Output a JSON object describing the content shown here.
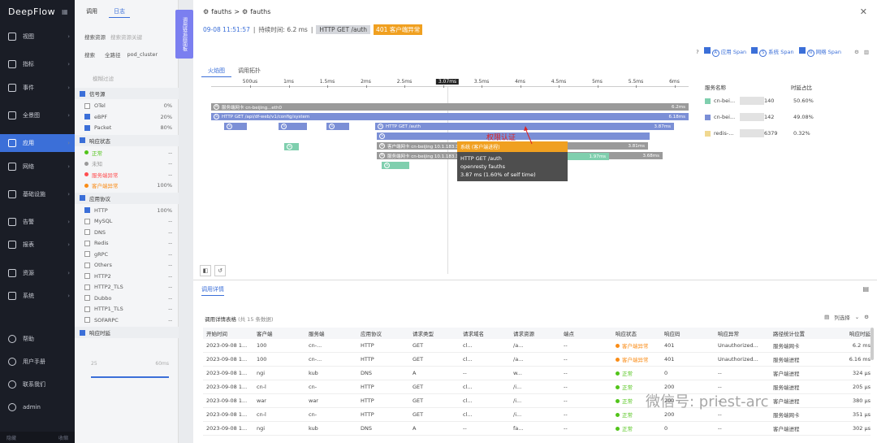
{
  "nav": {
    "logo": "DeepFlow",
    "items": [
      {
        "label": "视图"
      },
      {
        "label": "指标"
      },
      {
        "label": "事件"
      },
      {
        "label": "全景图"
      },
      {
        "label": "应用"
      },
      {
        "label": "网络"
      },
      {
        "label": "基础设施"
      },
      {
        "label": "告警"
      },
      {
        "label": "报表"
      },
      {
        "label": "资源"
      },
      {
        "label": "系统"
      }
    ],
    "bottom": [
      {
        "label": "帮助"
      },
      {
        "label": "用户手册"
      },
      {
        "label": "联系我们"
      },
      {
        "label": "admin"
      }
    ],
    "footer_left": "隐藏",
    "footer_right": "收缩"
  },
  "filter": {
    "tabs": [
      "调用",
      "日志"
    ],
    "search_label": "搜索资源",
    "search_placeholder": "搜索资源关键",
    "row2": [
      "搜索",
      "全路径",
      "pod_cluster"
    ],
    "filter_placeholder": "模糊过滤",
    "sections": [
      {
        "title": "信号源",
        "items": [
          {
            "label": "OTel",
            "count": "0%"
          },
          {
            "label": "eBPF",
            "count": "20%"
          },
          {
            "label": "Packet",
            "count": "80%"
          }
        ]
      },
      {
        "title": "响应状态",
        "items": [
          {
            "label": "正常",
            "count": "--",
            "color": "#52c41a"
          },
          {
            "label": "未知",
            "count": "--",
            "color": "#999999"
          },
          {
            "label": "服务端异常",
            "count": "--",
            "color": "#ff4d4f"
          },
          {
            "label": "客户端异常",
            "count": "100%",
            "color": "#fa8c16"
          }
        ]
      },
      {
        "title": "应用协议",
        "items": [
          {
            "label": "HTTP",
            "count": "100%"
          },
          {
            "label": "MySQL",
            "count": "--"
          },
          {
            "label": "DNS",
            "count": "--"
          },
          {
            "label": "Redis",
            "count": "--"
          },
          {
            "label": "gRPC",
            "count": "--"
          },
          {
            "label": "Others",
            "count": "--"
          },
          {
            "label": "HTTP2",
            "count": "--"
          },
          {
            "label": "HTTP2_TLS",
            "count": "--"
          },
          {
            "label": "Dubbo",
            "count": "--"
          },
          {
            "label": "HTTP1_TLS",
            "count": "--"
          },
          {
            "label": "SOFARPC",
            "count": "--"
          }
        ]
      },
      {
        "title": "响应时延",
        "items": []
      }
    ],
    "range_min": "25",
    "range_max": "60ms"
  },
  "sidetab": "调用链追踪面板",
  "drawer": {
    "breadcrumb": [
      "fauths",
      ">",
      "fauths"
    ],
    "meta": {
      "time": "09-08 11:51:57",
      "duration": "持续时间: 6.2 ms",
      "request": "HTTP GET /auth",
      "code": "401",
      "status": "客户端异常"
    },
    "legend": [
      {
        "label": "应用 Span",
        "tag": "A"
      },
      {
        "label": "系统 Span",
        "tag": "S"
      },
      {
        "label": "网络 Span",
        "tag": "N"
      }
    ],
    "view_tabs": [
      "火焰图",
      "调用拓扑"
    ],
    "ruler": {
      "ticks": [
        "500us",
        "1ms",
        "1.5ms",
        "2ms",
        "2.5ms",
        "3ms",
        "3.5ms",
        "4ms",
        "4.5ms",
        "5ms",
        "5.5ms",
        "6ms"
      ],
      "cursor": "3.07ms"
    },
    "spans": [
      {
        "tag": "N",
        "label": "服务端网卡 cn-beijing...eth0",
        "dur": "6.2ms",
        "color": "#9a9a9a",
        "masked": true
      },
      {
        "tag": "S",
        "label": "HTTP GET /api/df-web/v1/config/system",
        "dur": "6.18ms",
        "color": "#7b8fd6"
      },
      {
        "tag": "S",
        "label": "",
        "dur": "",
        "color": "#7b8fd6"
      },
      {
        "tag": "S",
        "label": "",
        "dur": "",
        "color": "#7b8fd6"
      },
      {
        "tag": "S",
        "label": "",
        "dur": "",
        "color": "#7b8fd6"
      },
      {
        "tag": "S",
        "label": "HTTP GET /auth",
        "dur": "3.87ms",
        "color": "#7b8fd6"
      },
      {
        "tag": "S",
        "label": "",
        "dur": "",
        "color": "#7b8fd6"
      },
      {
        "tag": "N",
        "label": "客户端网卡 cn-beijing 10.1.183.142...",
        "dur": "3.81ms",
        "color": "#9a9a9a"
      },
      {
        "tag": "S",
        "label": "",
        "dur": "",
        "color": "#7fcfae"
      },
      {
        "tag": "N",
        "label": "服务端网卡 cn-beijing 10.1.183.142...",
        "dur": "3.68ms",
        "color": "#9a9a9a"
      },
      {
        "tag": "S",
        "label": "",
        "dur": "",
        "color": "#7fcfae"
      },
      {
        "tag": "",
        "label": "",
        "dur": "1.97ms",
        "color": "#7fcfae"
      }
    ],
    "tooltip": {
      "header": "系统 (客户端进程)",
      "line1": "HTTP GET /auth",
      "line2": "openresty fauths",
      "line3": "3.87 ms (1.60% of self time)"
    },
    "annotation": "权限认证",
    "services": {
      "headers": [
        "服务名称",
        "时延占比"
      ],
      "rows": [
        {
          "name": "cn-bei...",
          "suffix": "140",
          "pct": "50.60%",
          "color": "#7fcfae"
        },
        {
          "name": "cn-bei...",
          "suffix": "142",
          "pct": "49.08%",
          "color": "#7b8fd6"
        },
        {
          "name": "redis-...",
          "suffix": "6379",
          "pct": "0.32%",
          "color": "#f0d890"
        }
      ]
    },
    "section_tab": "调用详情",
    "table": {
      "title": "调用详情表格",
      "count": "(共 15 条数据)",
      "col_select": "列选择",
      "headers": [
        "开始时间",
        "客户端",
        "服务端",
        "应用协议",
        "请求类型",
        "请求域名",
        "请求资源",
        "端点",
        "响应状态",
        "响应码",
        "响应异常",
        "路径统计位置",
        "响应时延"
      ],
      "rows": [
        [
          "2023-09-08 1...",
          "100",
          "cn-...",
          "HTTP",
          "GET",
          "cl...",
          "/a...",
          "--",
          "客户端异常",
          "401",
          "Unauthorized...",
          "服务端网卡",
          "6.2 ms"
        ],
        [
          "2023-09-08 1...",
          "100",
          "cn-...",
          "HTTP",
          "GET",
          "cl...",
          "/a...",
          "--",
          "客户端异常",
          "401",
          "Unauthorized...",
          "服务端进程",
          "6.16 ms"
        ],
        [
          "2023-09-08 1...",
          "ngi",
          "kub",
          "DNS",
          "A",
          "--",
          "w...",
          "--",
          "正常",
          "0",
          "--",
          "客户端进程",
          "324 μs"
        ],
        [
          "2023-09-08 1...",
          "cn-l",
          "cn-",
          "HTTP",
          "GET",
          "cl...",
          "/i...",
          "--",
          "正常",
          "200",
          "--",
          "服务端进程",
          "205 μs"
        ],
        [
          "2023-09-08 1...",
          "war",
          "war",
          "HTTP",
          "GET",
          "cl...",
          "/i...",
          "--",
          "正常",
          "200",
          "--",
          "客户端进程",
          "380 μs"
        ],
        [
          "2023-09-08 1...",
          "cn-l",
          "cn-",
          "HTTP",
          "GET",
          "cl...",
          "/i...",
          "--",
          "正常",
          "200",
          "--",
          "服务端网卡",
          "351 μs"
        ],
        [
          "2023-09-08 1...",
          "ngi",
          "kub",
          "DNS",
          "A",
          "--",
          "fa...",
          "--",
          "正常",
          "0",
          "--",
          "客户端进程",
          "302 μs"
        ]
      ]
    }
  },
  "watermark": "微信号: priest-arc",
  "colors": {
    "accent": "#3b6fd8",
    "warn": "#fa8c16",
    "ok": "#52c41a"
  }
}
